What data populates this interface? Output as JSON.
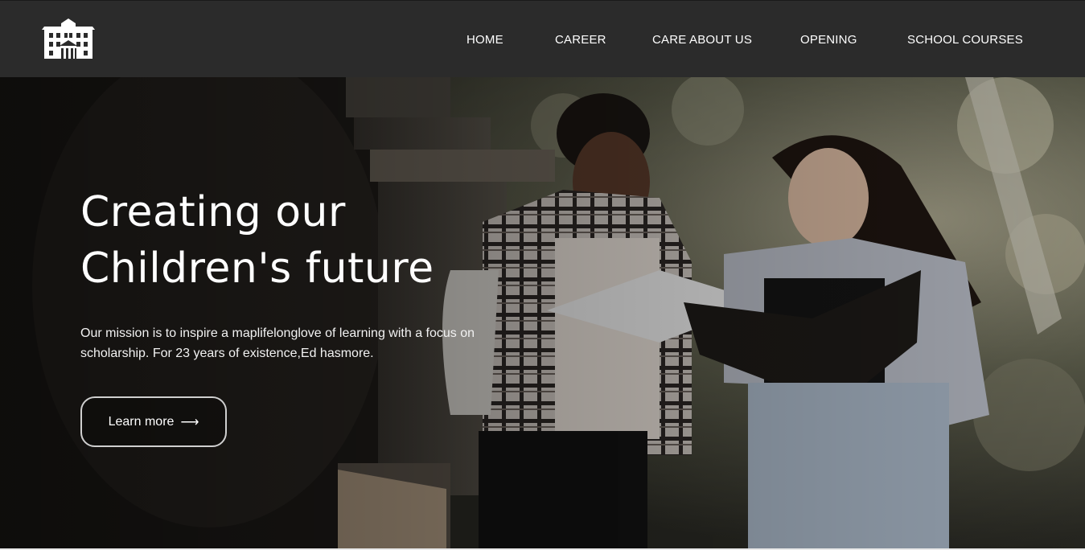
{
  "nav": {
    "logo_icon": "school-building-icon",
    "links": [
      {
        "label": "HOME"
      },
      {
        "label": "CAREER"
      },
      {
        "label": "CARE ABOUT US"
      },
      {
        "label": "OPENING"
      },
      {
        "label": "SCHOOL COURSES"
      }
    ]
  },
  "hero": {
    "headline_line1": "Creating our",
    "headline_line2": "Children's future",
    "subtext": "Our mission is to inspire a maplifelonglove of learning with a focus on scholarship. For 23 years of existence,Ed hasmore.",
    "cta_label": "Learn more",
    "cta_icon": "arrow-right-icon",
    "cta_arrow": "⟶"
  },
  "colors": {
    "nav_bg": "#2b2b2b",
    "text": "#ffffff"
  }
}
